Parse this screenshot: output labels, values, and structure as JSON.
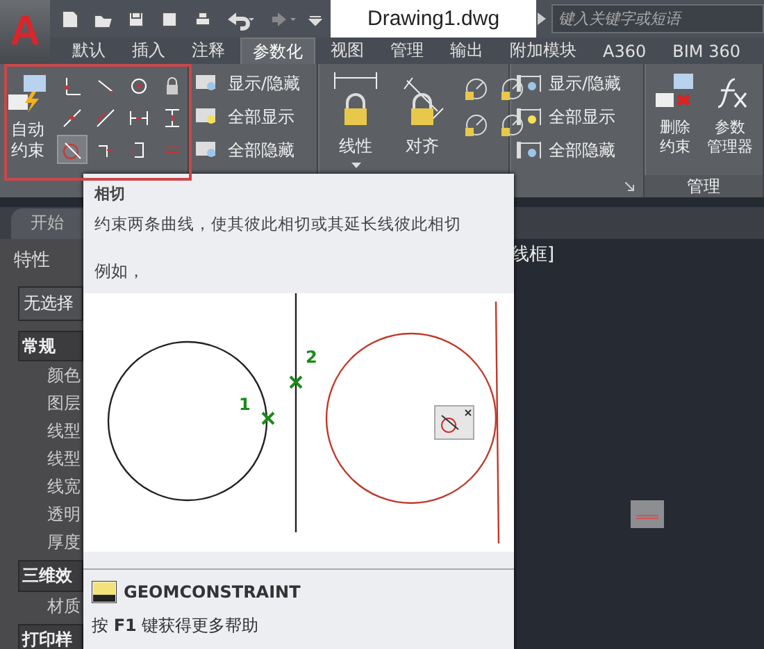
{
  "app_button": {
    "label": "A"
  },
  "title": "Drawing1.dwg",
  "search": {
    "placeholder": "键入关键字或短语"
  },
  "ribbon_tabs": [
    {
      "label": "默认",
      "selected": false
    },
    {
      "label": "插入",
      "selected": false
    },
    {
      "label": "注释",
      "selected": false
    },
    {
      "label": "参数化",
      "selected": true
    },
    {
      "label": "视图",
      "selected": false
    },
    {
      "label": "管理",
      "selected": false
    },
    {
      "label": "输出",
      "selected": false
    },
    {
      "label": "附加模块",
      "selected": false
    },
    {
      "label": "A360",
      "selected": false
    },
    {
      "label": "BIM 360",
      "selected": false
    }
  ],
  "geometric_panel": {
    "auto_button": "自动约束",
    "tools": [
      {
        "selected": false
      },
      {
        "selected": false
      },
      {
        "selected": false
      },
      {
        "selected": false
      },
      {
        "selected": false
      },
      {
        "selected": false
      },
      {
        "selected": false
      },
      {
        "selected": false
      },
      {
        "selected": true
      },
      {
        "selected": false
      },
      {
        "selected": false
      },
      {
        "selected": false
      }
    ]
  },
  "geometric_display": [
    "显示/隐藏",
    "全部显示",
    "全部隐藏"
  ],
  "dimensional_panel": {
    "buttons": [
      "线性",
      "对齐"
    ]
  },
  "dimensional_display": [
    "显示/隐藏",
    "全部显示",
    "全部隐藏"
  ],
  "manage_panel": {
    "buttons": [
      "删除约束",
      "参数管理器"
    ],
    "label": "管理"
  },
  "file_tabs": [
    {
      "label": "开始"
    }
  ],
  "properties_palette": {
    "title": "特性",
    "selection": "无选择",
    "groups": [
      {
        "label": "常规",
        "items": [
          "颜色",
          "图层",
          "线型",
          "线型",
          "线宽",
          "透明",
          "厚度"
        ]
      },
      {
        "label": "三维效",
        "items": [
          "材质"
        ]
      },
      {
        "label": "打印样"
      }
    ]
  },
  "viewport": {
    "label": "线框]"
  },
  "tooltip": {
    "title": "相切",
    "description": "约束两条曲线，使其彼此相切或其延长线彼此相切",
    "example": "例如，",
    "markers": [
      "1",
      "2"
    ],
    "command": "GEOMCONSTRAINT",
    "help": "按 **F1** 键获得更多帮助"
  }
}
